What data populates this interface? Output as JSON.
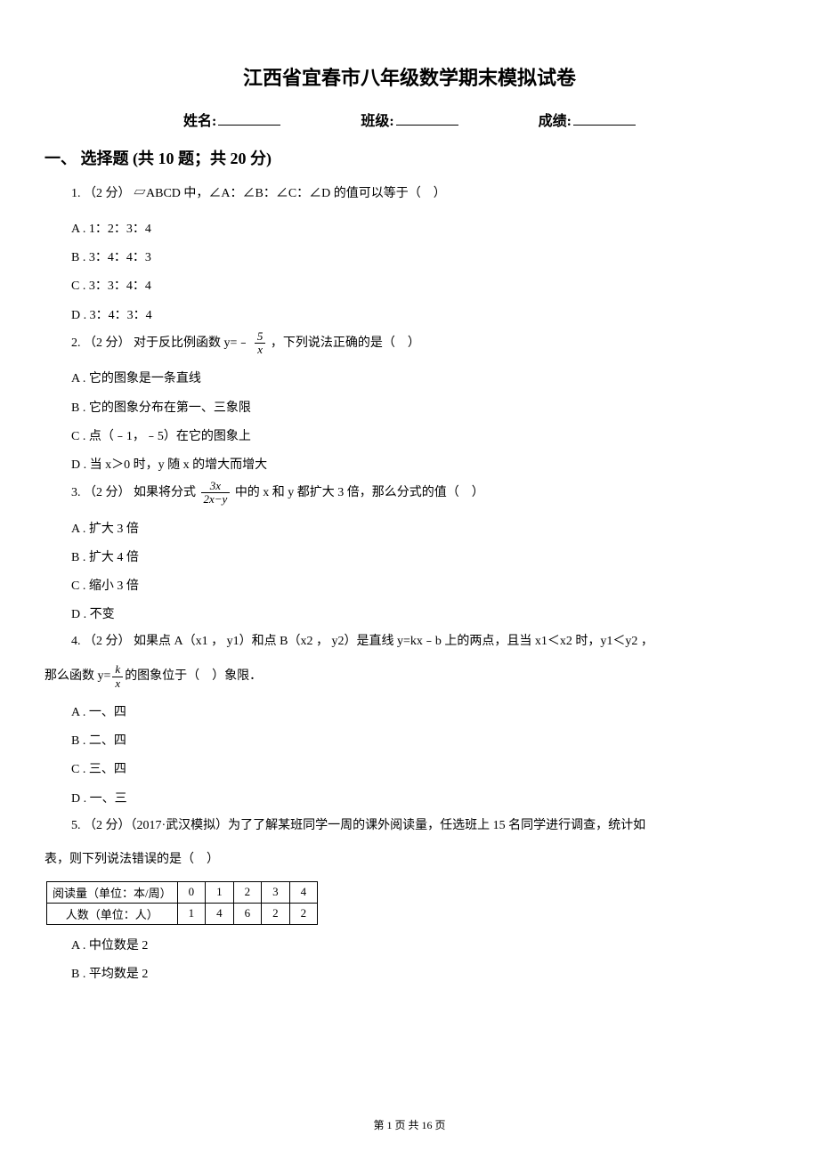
{
  "title": "江西省宜春市八年级数学期末模拟试卷",
  "header": {
    "name_label": "姓名:",
    "class_label": "班级:",
    "score_label": "成绩:"
  },
  "section1": {
    "heading": "一、 选择题 (共 10 题；共 20 分)"
  },
  "q1": {
    "text_a": "1. （2 分） ▱ABCD 中，∠A：∠B：∠C：∠D 的值可以等于（　）",
    "optA": "A . 1：2：3：4",
    "optB": "B . 3：4：4：3",
    "optC": "C . 3：3：4：4",
    "optD": "D . 3：4：3：4"
  },
  "q2": {
    "pre": "2. （2 分） 对于反比例函数 y=﹣",
    "frac_num": "5",
    "frac_den": "x",
    "post": " ，下列说法正确的是（　）",
    "optA": "A . 它的图象是一条直线",
    "optB": "B . 它的图象分布在第一、三象限",
    "optC": "C . 点（﹣1，﹣5）在它的图象上",
    "optD": "D . 当 x＞0 时，y 随 x 的增大而增大"
  },
  "q3": {
    "pre": "3. （2 分） 如果将分式 ",
    "frac_num": "3x",
    "frac_den": "2x−y",
    "post": " 中的 x 和 y 都扩大 3 倍，那么分式的值（　）",
    "optA": "A . 扩大 3 倍",
    "optB": "B . 扩大 4 倍",
    "optC": "C . 缩小 3 倍",
    "optD": "D . 不变"
  },
  "q4": {
    "line1": "4. （2 分） 如果点 A（x1 ， y1）和点 B（x2 ， y2）是直线 y=kx﹣b 上的两点，且当 x1＜x2 时，y1＜y2 ，",
    "line2_pre": "那么函数 y=",
    "frac_num": "k",
    "frac_den": "x",
    "line2_post": "的图象位于（　）象限．",
    "optA": "A . 一、四",
    "optB": "B . 二、四",
    "optC": "C . 三、四",
    "optD": "D . 一、三"
  },
  "q5": {
    "line1": "5. （2 分）（2017·武汉模拟）为了了解某班同学一周的课外阅读量，任选班上 15 名同学进行调查，统计如",
    "line2": "表，则下列说法错误的是（　）",
    "table": {
      "row_header1": "阅读量（单位：本/周）",
      "row_header2": "人数（单位：人）",
      "cols": [
        "0",
        "1",
        "2",
        "3",
        "4"
      ],
      "vals": [
        "1",
        "4",
        "6",
        "2",
        "2"
      ]
    },
    "optA": "A . 中位数是 2",
    "optB": "B . 平均数是 2"
  },
  "footer": "第 1 页 共 16 页"
}
